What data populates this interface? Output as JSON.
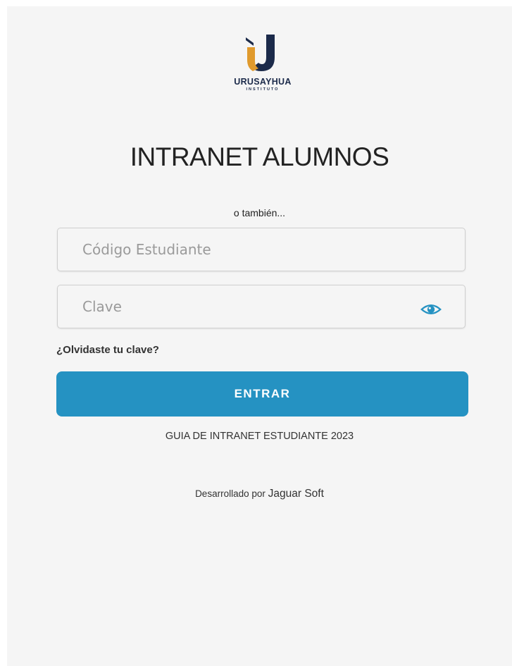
{
  "logo": {
    "name": "URUSAYHUA",
    "subtitle": "INSTITUTO",
    "icon": "u-logo-icon",
    "colors": {
      "navy": "#1b2a4a",
      "gold": "#e09a2d"
    }
  },
  "title": "INTRANET ALUMNOS",
  "subtitle": "o también...",
  "form": {
    "code_placeholder": "Código Estudiante",
    "code_value": "",
    "password_placeholder": "Clave",
    "password_value": "",
    "toggle_icon": "eye-icon",
    "forgot_label": "¿Olvidaste tu clave?",
    "submit_label": "ENTRAR"
  },
  "guide_link": "GUIA DE INTRANET ESTUDIANTE 2023",
  "footer": {
    "prefix": "Desarrollado por",
    "brand": "Jaguar Soft"
  },
  "colors": {
    "accent": "#2592c2",
    "background": "#f5f5f5",
    "text": "#222222"
  }
}
